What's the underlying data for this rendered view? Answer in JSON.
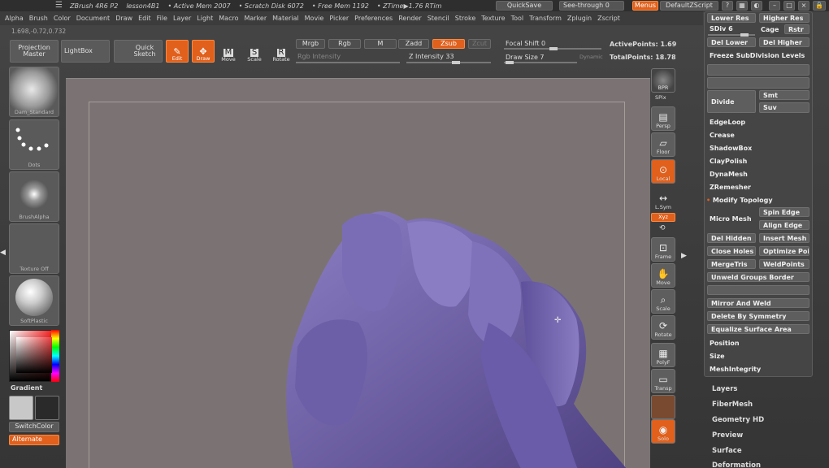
{
  "titlebar": {
    "app": "ZBrush 4R6 P2",
    "doc": "lesson4B1",
    "active_mem": "• Active Mem 2007",
    "scratch": "• Scratch Disk 6072",
    "free_mem": "• Free Mem 1192",
    "ztime": "• ZTime▶1.76 RTim",
    "quicksave": "QuickSave",
    "see_through": "See-through",
    "see_through_value": "0",
    "menus": "Menus",
    "script": "DefaultZScript"
  },
  "menubar": [
    "Alpha",
    "Brush",
    "Color",
    "Document",
    "Draw",
    "Edit",
    "File",
    "Layer",
    "Light",
    "Macro",
    "Marker",
    "Material",
    "Movie",
    "Picker",
    "Preferences",
    "Render",
    "Stencil",
    "Stroke",
    "Texture",
    "Tool",
    "Transform",
    "Zplugin",
    "Zscript"
  ],
  "coords": "1.698,-0.72,0.732",
  "toolbar": {
    "projection_master": "Projection Master",
    "lightbox": "LightBox",
    "quick_sketch": "Quick Sketch",
    "edit": "Edit",
    "draw": "Draw",
    "move": "Move",
    "scale": "Scale",
    "rotate": "Rotate",
    "mrgb": "Mrgb",
    "rgb": "Rgb",
    "m": "M",
    "zadd": "Zadd",
    "zsub": "Zsub",
    "zcut": "Zcut",
    "rgb_intensity": "Rgb Intensity",
    "z_intensity_label": "Z Intensity",
    "z_intensity": "33",
    "focal_shift_label": "Focal Shift",
    "focal_shift": "0",
    "draw_size_label": "Draw Size",
    "draw_size": "7",
    "dynamic": "Dynamic",
    "active_points_label": "ActivePoints:",
    "active_points": "1.69",
    "total_points_label": "TotalPoints:",
    "total_points": "18.78"
  },
  "left_shelf": {
    "brush": "Dam_Standard",
    "stroke": "Dots",
    "alpha": "BrushAlpha",
    "texture": "Texture Off",
    "material": "SoftPlastic",
    "gradient": "Gradient",
    "switch_color": "SwitchColor",
    "alternate": "Alternate"
  },
  "right_shelf": [
    "BPR",
    "SPix",
    "Persp",
    "Floor",
    "Local",
    "L.Sym",
    "Xyz",
    "Frame",
    "Move",
    "Scale",
    "Rotate",
    "PolyF",
    "Transp",
    "Ghost",
    "Solo"
  ],
  "geometry": {
    "lower_res": "Lower Res",
    "higher_res": "Higher Res",
    "sdiv_label": "SDiv",
    "sdiv": "6",
    "cage": "Cage",
    "rstr": "Rstr",
    "del_lower": "Del Lower",
    "del_higher": "Del Higher",
    "freeze": "Freeze SubDivision Levels",
    "divide": "Divide",
    "smt": "Smt",
    "suv": "Suv",
    "edgeloop": "EdgeLoop",
    "crease": "Crease",
    "shadowbox": "ShadowBox",
    "claypolish": "ClayPolish",
    "dynamesh": "DynaMesh",
    "zremesher": "ZRemesher",
    "modify_topology": "Modify Topology",
    "micro_mesh": "Micro Mesh",
    "spin_edge": "Spin Edge",
    "align_edge": "Align Edge",
    "del_hidden": "Del Hidden",
    "insert_mesh": "Insert Mesh",
    "close_holes": "Close Holes",
    "optimize_points": "Optimize Poi",
    "mergetris": "MergeTris",
    "weldpoints": "WeldPoints",
    "unweld_groups_border": "Unweld Groups Border",
    "mirror_and_weld": "Mirror And Weld",
    "delete_by_symmetry": "Delete By Symmetry",
    "equalize_surface_area": "Equalize Surface Area",
    "position": "Position",
    "size": "Size",
    "meshintegrity": "MeshIntegrity"
  },
  "tool_sections": [
    "Layers",
    "FiberMesh",
    "Geometry HD",
    "Preview",
    "Surface",
    "Deformation"
  ],
  "colors": {
    "accent": "#e0601c",
    "mesh": "#6f5fa6",
    "canvas": "#7b7373"
  }
}
